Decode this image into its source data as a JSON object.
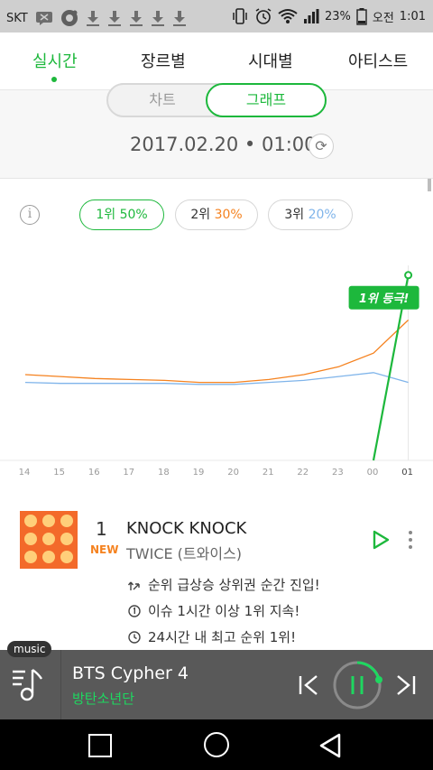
{
  "status_bar": {
    "carrier": "SKT",
    "battery": "23%",
    "ampm": "오전",
    "time": "1:01"
  },
  "tabs": [
    {
      "label": "실시간",
      "active": true
    },
    {
      "label": "장르별",
      "active": false
    },
    {
      "label": "시대별",
      "active": false
    },
    {
      "label": "아티스트",
      "active": false
    }
  ],
  "view_toggle": {
    "chart": "차트",
    "graph": "그래프",
    "selected": "그래프"
  },
  "datetime": "2017.02.20 • 01:00",
  "legend": [
    {
      "rank": "1위",
      "pct": "50%",
      "color": "#1db83c"
    },
    {
      "rank": "2위",
      "pct": "30%",
      "color": "#f5821f"
    },
    {
      "rank": "3위",
      "pct": "20%",
      "color": "#7fb4ea"
    }
  ],
  "chart_data": {
    "type": "line",
    "x": [
      "14",
      "15",
      "16",
      "17",
      "18",
      "19",
      "20",
      "21",
      "22",
      "23",
      "00",
      "01"
    ],
    "series": [
      {
        "name": "1위",
        "color": "#1db83c",
        "values": [
          null,
          null,
          null,
          null,
          null,
          null,
          null,
          null,
          null,
          null,
          0,
          95
        ]
      },
      {
        "name": "2위",
        "color": "#f5821f",
        "values": [
          44,
          43,
          42,
          41.5,
          41,
          40,
          40,
          41.5,
          44,
          48,
          55,
          72
        ]
      },
      {
        "name": "3위",
        "color": "#7fb4ea",
        "values": [
          40,
          39.5,
          39.5,
          39.5,
          39.5,
          39,
          39,
          40,
          41,
          43,
          45,
          40
        ]
      }
    ],
    "callout": "1위 등극!",
    "ylim": [
      0,
      100
    ]
  },
  "song": {
    "rank": "1",
    "badge": "NEW",
    "title": "KNOCK KNOCK",
    "artist": "TWICE (트와이스)",
    "notes": [
      {
        "icon": "rank-up-icon",
        "text": "순위 급상승 상위권 순간 진입!"
      },
      {
        "icon": "first-place-hold-icon",
        "text": "이슈 1시간 이상 1위 지속!"
      },
      {
        "icon": "clock-icon",
        "text": "24시간 내 최고 순위 1위!"
      }
    ]
  },
  "player": {
    "tag": "music",
    "title": "BTS Cypher 4",
    "artist": "방탄소년단"
  }
}
